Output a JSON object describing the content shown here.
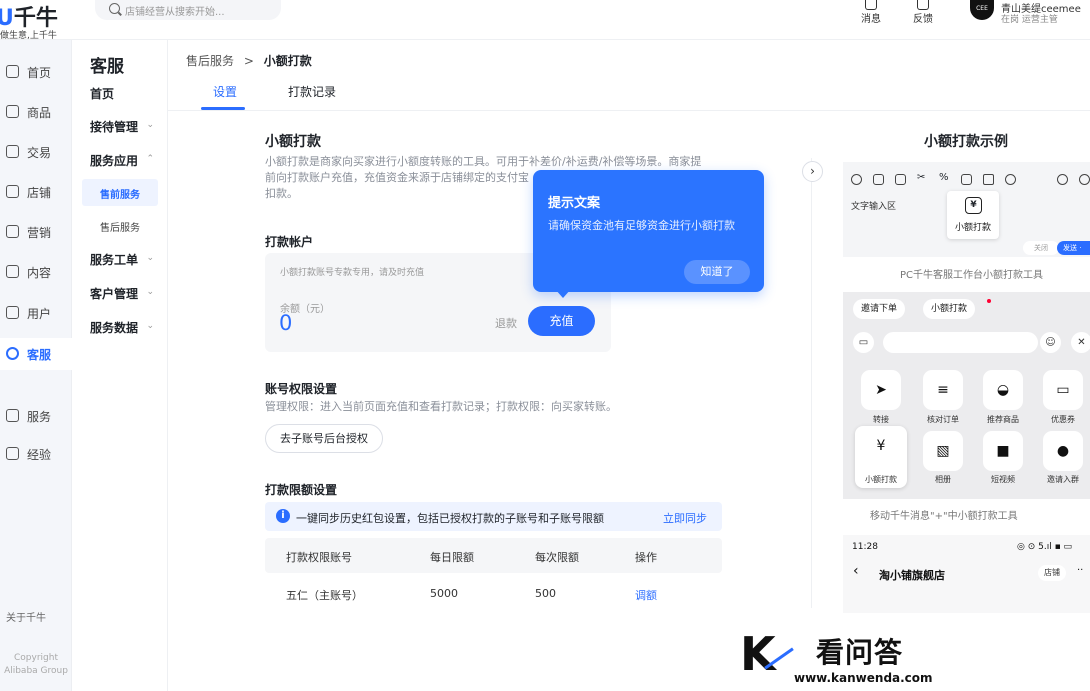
{
  "header": {
    "logo": "千牛",
    "slogan": "做生意,上千牛",
    "search_placeholder": "店铺经营从搜索开始...",
    "messages_label": "消息",
    "feedback_label": "反馈",
    "user_name": "青山美缇ceemee",
    "user_status": "在岗 运营主管",
    "avatar_text": "CEE MEE"
  },
  "rail": {
    "items": [
      {
        "label": "首页",
        "icon": "home-icon"
      },
      {
        "label": "商品",
        "icon": "goods-icon"
      },
      {
        "label": "交易",
        "icon": "trade-icon"
      },
      {
        "label": "店铺",
        "icon": "shop-icon"
      },
      {
        "label": "营销",
        "icon": "marketing-icon"
      },
      {
        "label": "内容",
        "icon": "content-icon"
      },
      {
        "label": "用户",
        "icon": "user-icon"
      },
      {
        "label": "客服",
        "icon": "service-icon"
      },
      {
        "label": "服务",
        "icon": "apps-icon"
      },
      {
        "label": "经验",
        "icon": "experience-icon"
      }
    ],
    "active_label": "客服",
    "about": "关于千牛",
    "copyright_1": "Copyright",
    "copyright_2": "Alibaba Group"
  },
  "subnav": {
    "title": "客服",
    "items": [
      {
        "label": "首页"
      },
      {
        "label": "接待管理"
      },
      {
        "label": "服务应用"
      },
      {
        "label": "服务工单"
      },
      {
        "label": "客户管理"
      },
      {
        "label": "服务数据"
      }
    ],
    "sub_items": [
      {
        "label": "售前服务"
      },
      {
        "label": "售后服务"
      }
    ]
  },
  "breadcrumb": {
    "parent": "售后服务",
    "sep": ">",
    "current": "小额打款"
  },
  "tabs": [
    {
      "label": "设置"
    },
    {
      "label": "打款记录"
    }
  ],
  "main": {
    "title": "小额打款",
    "desc_line1": "小额打款是商家向买家进行小额度转账的工具。可用于补差价/补运费/补偿等场景。商家提",
    "desc_line2": "前向打款账户充值，充值资金来源于店铺绑定的支付宝",
    "desc_line3": "扣款。",
    "account_section": "打款帐户",
    "account_note": "小额打款账号专款专用，请及时充值",
    "balance_label": "余额（元）",
    "balance_value": "0",
    "refund_label": "退款",
    "recharge_label": "充值",
    "perm_section": "账号权限设置",
    "perm_desc": "管理权限：进入当前页面充值和查看打款记录；打款权限：向买家转账。",
    "perm_button": "去子账号后台授权",
    "limit_section": "打款限额设置",
    "sync_text": "一键同步历史红包设置，包括已授权打款的子账号和子账号限额",
    "sync_link": "立即同步",
    "table_headers": [
      "打款权限账号",
      "每日限额",
      "每次限额",
      "操作"
    ],
    "table_rows": [
      {
        "account": "五仁（主账号）",
        "daily": "5000",
        "each": "500",
        "action": "调额"
      }
    ]
  },
  "popover": {
    "title": "提示文案",
    "text": "请确保资金池有足够资金进行小额打款",
    "button": "知道了"
  },
  "examples": {
    "title": "小额打款示例",
    "ex1_input_label": "文字输入区",
    "ex1_pop_label": "小额打款",
    "ex1_btn_close": "关闭",
    "ex1_btn_send": "发送 ·",
    "ex1_caption": "PC千牛客服工作台小额打款工具",
    "ex2_chip1": "邀请下单",
    "ex2_chip2": "小额打款",
    "ex2_tools": [
      {
        "label": "转接",
        "glyph": "➤"
      },
      {
        "label": "核对订单",
        "glyph": "≡"
      },
      {
        "label": "推荐商品",
        "glyph": "◒"
      },
      {
        "label": "优惠券",
        "glyph": "▭"
      },
      {
        "label": "小额打款",
        "glyph": "¥"
      },
      {
        "label": "相册",
        "glyph": "▧"
      },
      {
        "label": "短视频",
        "glyph": "■"
      },
      {
        "label": "邀请入群",
        "glyph": "●"
      }
    ],
    "ex2_caption": "移动千牛消息\"+\"中小额打款工具",
    "ex3_time": "11:28",
    "ex3_status": "◎ ⊙ 5.ıl ▪ ▭",
    "ex3_shop": "淘小铺旗舰店",
    "ex3_shop_btn": "店铺",
    "ex3_more": "··"
  },
  "watermark": {
    "letter": "K",
    "text": "看问答",
    "url": "www.kanwenda.com"
  },
  "colors": {
    "accent": "#2b6dff",
    "popover": "#2b74ff"
  }
}
